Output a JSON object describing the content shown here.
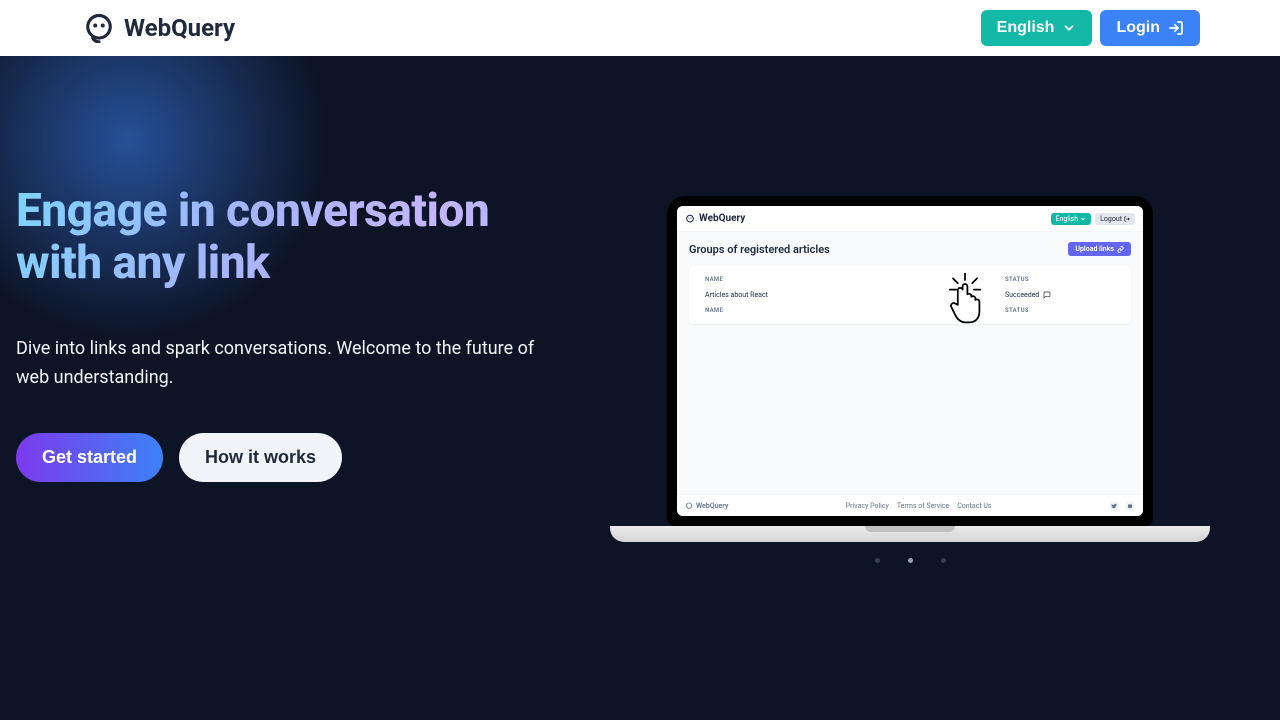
{
  "header": {
    "brand": "WebQuery",
    "language_label": "English",
    "login_label": "Login"
  },
  "hero": {
    "title": "Engage in conversation with any link",
    "subtitle": "Dive into links and spark conversations. Welcome to the future of web understanding.",
    "cta_primary": "Get started",
    "cta_secondary": "How it works"
  },
  "screen": {
    "brand": "WebQuery",
    "language": "English",
    "logout": "Logout",
    "title": "Groups of registered articles",
    "upload": "Upload links",
    "col_name": "NAME",
    "col_status": "STATUS",
    "row1_name": "Articles about React",
    "row1_status": "Succeeded",
    "footer_brand": "WebQuery",
    "footer_privacy": "Privacy Policy",
    "footer_terms": "Terms of Service",
    "footer_contact": "Contact Us"
  },
  "carousel": {
    "active_index": 1,
    "count": 3
  }
}
